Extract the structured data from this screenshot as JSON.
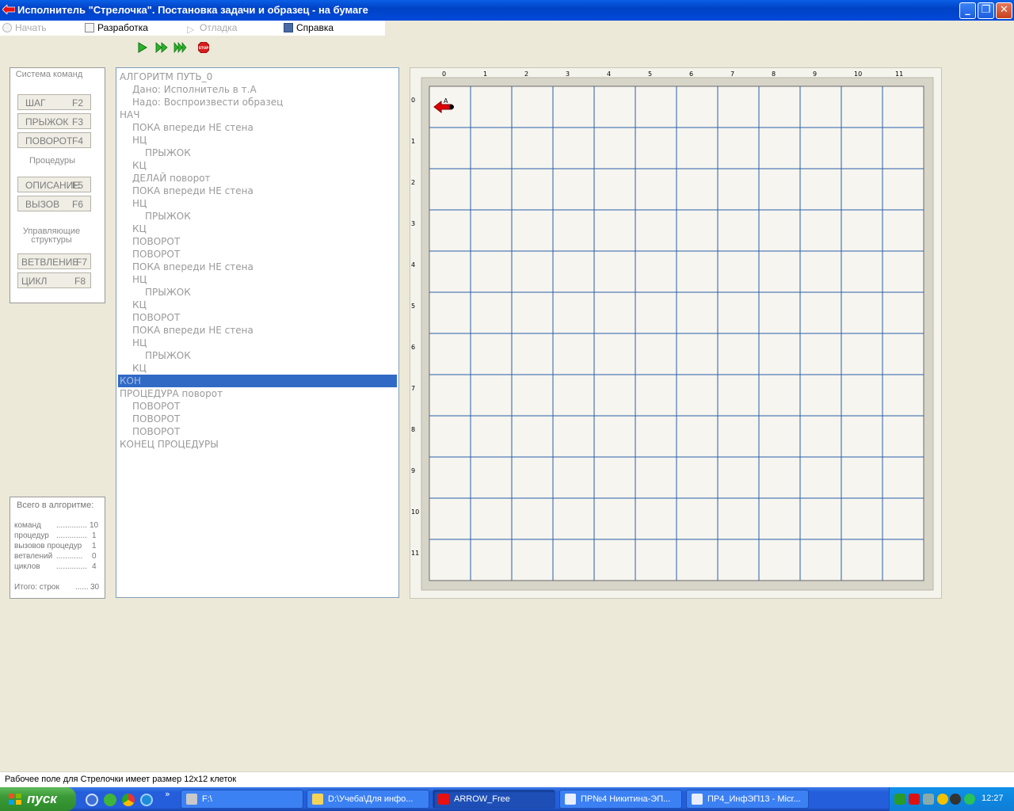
{
  "window": {
    "title": "Исполнитель \"Стрелочка\". Постановка задачи и образец - на бумаге",
    "buttons": [
      "_",
      "❐",
      "✕"
    ]
  },
  "menu": {
    "items": [
      {
        "label": "Начать",
        "enabled": false
      },
      {
        "label": "Разработка",
        "enabled": true
      },
      {
        "label": "Отладка",
        "enabled": false
      },
      {
        "label": "Справка",
        "enabled": true
      }
    ]
  },
  "toolbar": {
    "buttons": [
      "run-icon",
      "step-icon",
      "fast-run-icon",
      "stop-icon"
    ],
    "stop_label": "STOP"
  },
  "commands": {
    "system_label": "Система команд",
    "system": [
      {
        "label": "ШАГ",
        "key": "F2"
      },
      {
        "label": "ПРЫЖОК",
        "key": "F3"
      },
      {
        "label": "ПОВОРОТ",
        "key": "F4"
      }
    ],
    "procedures_label": "Процедуры",
    "procedures": [
      {
        "label": "ОПИСАНИЕ",
        "key": "F5"
      },
      {
        "label": "ВЫЗОВ",
        "key": "F6"
      }
    ],
    "control_label": "Управляющие структуры",
    "control": [
      {
        "label": "ВЕТВЛЕНИЕ",
        "key": "F7"
      },
      {
        "label": "ЦИКЛ",
        "key": "F8"
      }
    ]
  },
  "code": {
    "lines": [
      {
        "text": "АЛГОРИТМ ПУТЬ_0",
        "indent": 0
      },
      {
        "text": "Дано: Исполнитель в т.А",
        "indent": 1
      },
      {
        "text": "Надо: Воспроизвести образец",
        "indent": 1
      },
      {
        "text": "НАЧ",
        "indent": 0
      },
      {
        "text": "ПОКА впереди НЕ стена",
        "indent": 1
      },
      {
        "text": "НЦ",
        "indent": 1
      },
      {
        "text": "ПРЫЖОК",
        "indent": 2
      },
      {
        "text": "КЦ",
        "indent": 1
      },
      {
        "text": "ДЕЛАЙ поворот",
        "indent": 1
      },
      {
        "text": "ПОКА впереди НЕ стена",
        "indent": 1
      },
      {
        "text": "НЦ",
        "indent": 1
      },
      {
        "text": "ПРЫЖОК",
        "indent": 2
      },
      {
        "text": "КЦ",
        "indent": 1
      },
      {
        "text": "ПОВОРОТ",
        "indent": 1
      },
      {
        "text": "ПОВОРОТ",
        "indent": 1
      },
      {
        "text": "ПОКА впереди НЕ стена",
        "indent": 1
      },
      {
        "text": "НЦ",
        "indent": 1
      },
      {
        "text": "ПРЫЖОК",
        "indent": 2
      },
      {
        "text": "КЦ",
        "indent": 1
      },
      {
        "text": "ПОВОРОТ",
        "indent": 1
      },
      {
        "text": "ПОКА впереди НЕ стена",
        "indent": 1
      },
      {
        "text": "НЦ",
        "indent": 1
      },
      {
        "text": "ПРЫЖОК",
        "indent": 2
      },
      {
        "text": "КЦ",
        "indent": 1
      },
      {
        "text": "КОН",
        "indent": 0,
        "selected": true
      },
      {
        "text": "ПРОЦЕДУРА поворот",
        "indent": 0
      },
      {
        "text": "ПОВОРОТ",
        "indent": 1
      },
      {
        "text": "ПОВОРОТ",
        "indent": 1
      },
      {
        "text": "ПОВОРОТ",
        "indent": 1
      },
      {
        "text": "КОНЕЦ ПРОЦЕДУРЫ",
        "indent": 0
      }
    ]
  },
  "stats": {
    "header": "Всего в алгоритме:",
    "rows": [
      {
        "label": "команд",
        "dots": "..............",
        "value": "10"
      },
      {
        "label": "процедур",
        "dots": "..............",
        "value": "1"
      },
      {
        "label": "вызовов процедур",
        "dots": "",
        "value": "1"
      },
      {
        "label": "ветвлений",
        "dots": "............",
        "value": "0"
      },
      {
        "label": "циклов",
        "dots": "..............",
        "value": "4"
      }
    ],
    "total_label": "Итого:  строк",
    "total_dots": "......",
    "total_value": "30"
  },
  "field": {
    "cols": [
      "0",
      "1",
      "2",
      "3",
      "4",
      "5",
      "6",
      "7",
      "8",
      "9",
      "10",
      "11"
    ],
    "rows": [
      "0",
      "1",
      "2",
      "3",
      "4",
      "5",
      "6",
      "7",
      "8",
      "9",
      "10",
      "11"
    ],
    "grid_color": "#2b5fa8",
    "arrow": {
      "row": 0,
      "col": 0,
      "direction": "left",
      "color": "#e00000",
      "label": "А"
    }
  },
  "status": {
    "text": "Рабочее поле для Стрелочки имеет размер 12x12 клеток"
  },
  "taskbar": {
    "start_label": "пуск",
    "tasks": [
      {
        "label": "F:\\",
        "icon": "drive-icon",
        "active": false
      },
      {
        "label": "D:\\Учеба\\Для инфо...",
        "icon": "folder-icon",
        "active": false
      },
      {
        "label": "ARROW_Free",
        "icon": "arrow-app-icon",
        "active": true
      },
      {
        "label": "ПР№4 Никитина-ЭП...",
        "icon": "word-icon",
        "active": false
      },
      {
        "label": "ПР4_ИнфЭП13 - Micr...",
        "icon": "word-icon",
        "active": false
      }
    ],
    "clock": "12:27"
  }
}
